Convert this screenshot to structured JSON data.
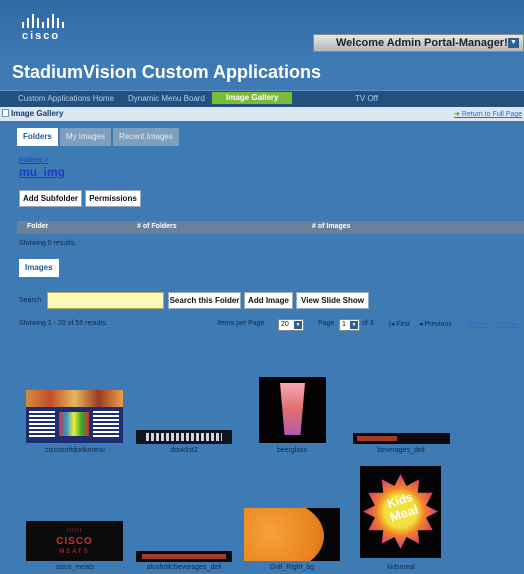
{
  "header": {
    "brand": "cisco",
    "welcome": "Welcome Admin Portal-Manager!",
    "app_title": "StadiumVision Custom Applications"
  },
  "nav": {
    "items": [
      "Custom Applications Home",
      "Dynamic Menu Board",
      "Image Gallery",
      "TV Off"
    ],
    "active_index": 2
  },
  "section": {
    "title": "Image Gallery",
    "return_link": "Return to Full Page"
  },
  "tabs": [
    "Folders",
    "My Images",
    "Recent Images"
  ],
  "breadcrumb": "Folders >",
  "current_folder": "mu_img",
  "buttons": {
    "add_subfolder": "Add Subfolder",
    "permissions": "Permissions"
  },
  "folders_table": {
    "columns": [
      "Folder",
      "# of Folders",
      "# of Images"
    ],
    "status": "Showing 0 results."
  },
  "images_tab": "Images",
  "search": {
    "label": "Search",
    "value": "",
    "search_button": "Search this Folder",
    "add_image_button": "Add Image",
    "slideshow_button": "View Slide Show"
  },
  "results": {
    "status": "Showing 1 - 20 of 55 results.",
    "items_per_page_label": "Items per Page",
    "items_per_page": "20",
    "page_label": "Page",
    "page": "1",
    "of_label": "of 3",
    "first": "First",
    "previous": "Previous",
    "next": "Next",
    "last": "Last"
  },
  "images": [
    {
      "caption": "ciscosoftdrinkmenu"
    },
    {
      "caption": "drinklist2"
    },
    {
      "caption": "beerglass"
    },
    {
      "caption": "beverages_deli"
    },
    {
      "caption": "cisco_meats"
    },
    {
      "caption": "alcoholicbeverages_deli"
    },
    {
      "caption": "Grill_Right_bg"
    },
    {
      "caption": "kidsmeal"
    }
  ],
  "thumb_text": {
    "cisco_word": "CISCO",
    "meats_word": "MEATS",
    "kids_line1": "Kids",
    "kids_line2": "Meal"
  },
  "colors": {
    "background": "#3e7ab4",
    "nav_active": "#7cbb3a",
    "search_field": "#fff8b8"
  }
}
